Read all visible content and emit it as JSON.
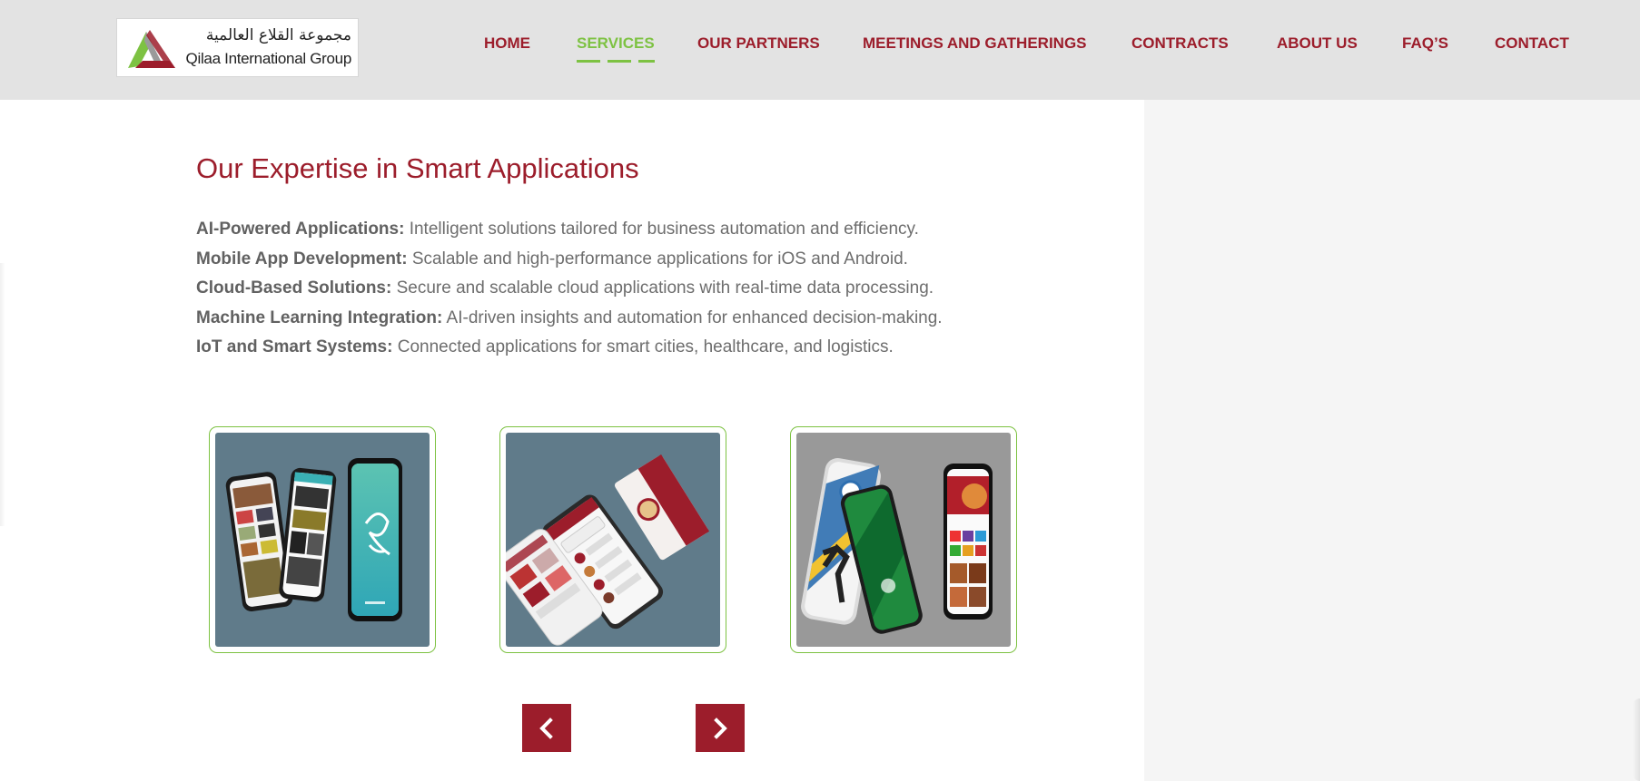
{
  "logo": {
    "arabic": "مجموعة القلاع العالمية",
    "english": "Qilaa International Group"
  },
  "nav": {
    "items": [
      {
        "label": "HOME",
        "active": false
      },
      {
        "label": "SERVICES",
        "active": true
      },
      {
        "label": "OUR PARTNERS",
        "active": false
      },
      {
        "label": "MEETINGS AND GATHERINGS",
        "active": false
      },
      {
        "label": "CONTRACTS",
        "active": false
      },
      {
        "label": "ABOUT US",
        "active": false
      },
      {
        "label": "FAQ’S",
        "active": false
      },
      {
        "label": "CONTACT",
        "active": false
      }
    ]
  },
  "main": {
    "title": "Our Expertise in Smart Applications",
    "features": [
      {
        "name": "AI-Powered Applications:",
        "text": " Intelligent solutions tailored for business automation and efficiency."
      },
      {
        "name": "Mobile App Development:",
        "text": " Scalable and high-performance applications for iOS and Android."
      },
      {
        "name": "Cloud-Based Solutions:",
        "text": " Secure and scalable cloud applications with real-time data processing."
      },
      {
        "name": "Machine Learning Integration:",
        "text": " AI-driven insights and automation for enhanced decision-making."
      },
      {
        "name": "IoT and Smart Systems:",
        "text": " Connected applications for smart cities, healthcare, and logistics."
      }
    ]
  },
  "carousel": {
    "prev_icon": "chevron-left-icon",
    "next_icon": "chevron-right-icon"
  },
  "colors": {
    "brand": "#9c1d2b",
    "accent": "#7dc242",
    "header_bg": "#e3e3e3"
  }
}
